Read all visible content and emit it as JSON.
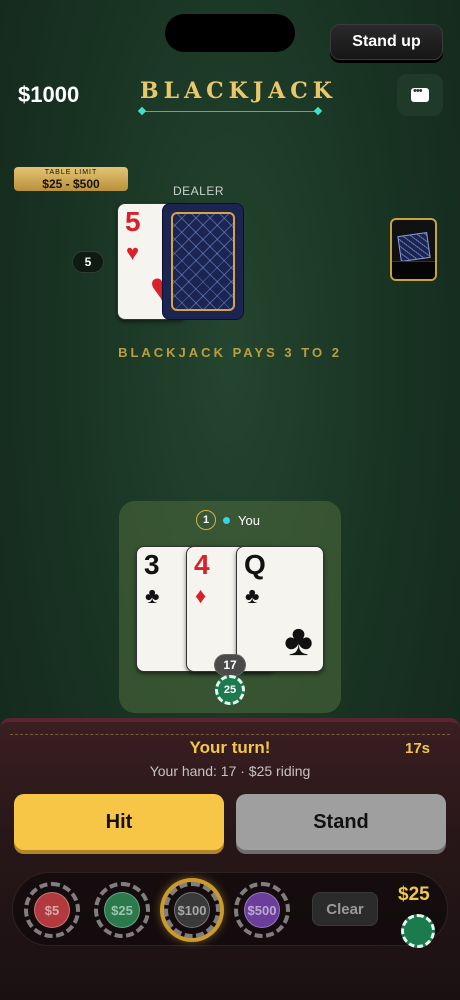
{
  "header": {
    "stand_up_label": "Stand up",
    "balance": "$1000",
    "title": "BLACKJACK"
  },
  "table": {
    "limit_label": "TABLE LIMIT",
    "limit_value": "$25 - $500",
    "dealer_label": "DEALER",
    "dealer_score": "5",
    "dealer_cards": [
      {
        "rank": "5",
        "suit": "♥",
        "color": "#d7212b",
        "face_up": true
      },
      {
        "face_up": false
      }
    ],
    "pays_text": "BLACKJACK PAYS 3 TO 2"
  },
  "player": {
    "seat_number": "1",
    "name": "You",
    "cards": [
      {
        "rank": "3",
        "suit": "♣",
        "color": "#111111"
      },
      {
        "rank": "4",
        "suit": "♦",
        "color": "#d7212b"
      },
      {
        "rank": "Q",
        "suit": "♣",
        "color": "#111111"
      }
    ],
    "score": "17",
    "bet_chip": "25"
  },
  "controls": {
    "turn_text": "Your turn!",
    "timer": "17s",
    "hand_info": "Your hand: 17 · $25 riding",
    "hit_label": "Hit",
    "stand_label": "Stand",
    "chips": [
      {
        "label": "$5",
        "color": "#b23a3e"
      },
      {
        "label": "$25",
        "color": "#2a7a4c"
      },
      {
        "label": "$100",
        "color": "#3a3a3a",
        "selected": true
      },
      {
        "label": "$500",
        "color": "#6a3e9a"
      }
    ],
    "clear_label": "Clear",
    "bet_total": "$25"
  }
}
